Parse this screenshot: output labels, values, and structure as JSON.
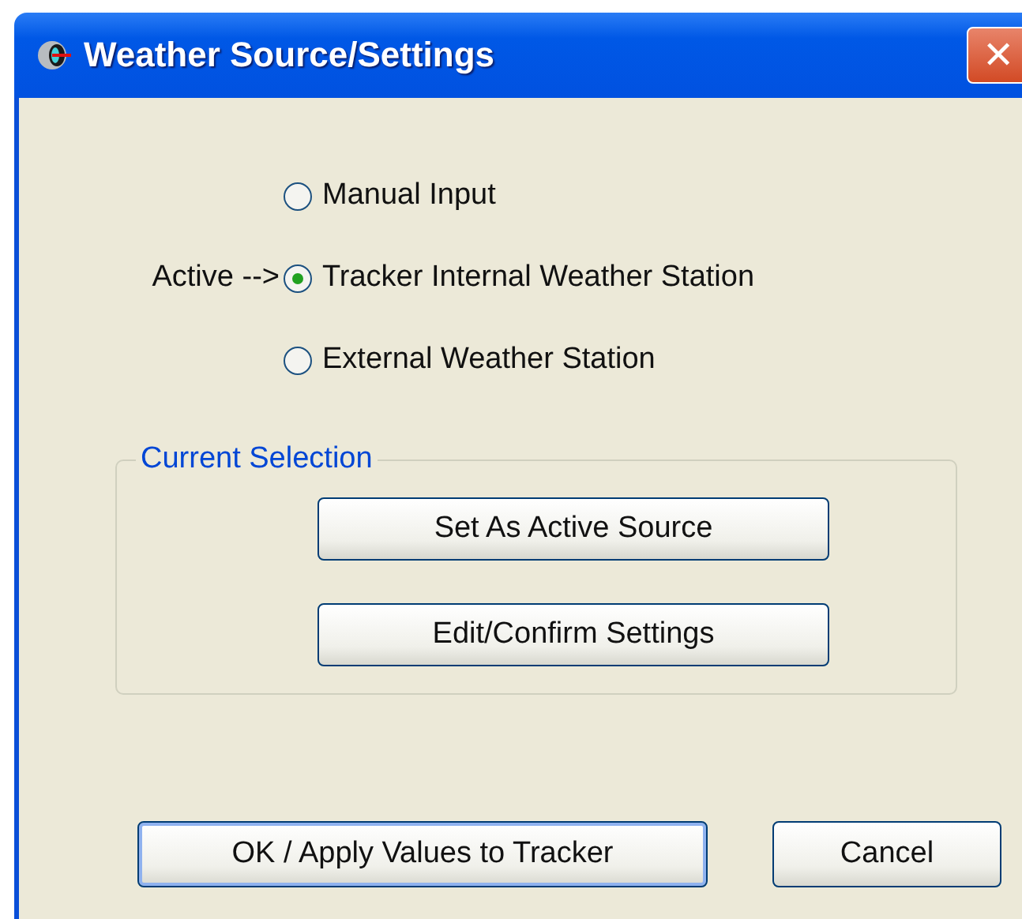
{
  "window": {
    "title": "Weather Source/Settings",
    "close": "✕"
  },
  "sources": [
    {
      "label": "Manual Input",
      "selected": false
    },
    {
      "label": "Tracker Internal Weather Station",
      "selected": true,
      "active_label": "Active -->"
    },
    {
      "label": "External Weather Station",
      "selected": false
    }
  ],
  "current_selection": {
    "legend": "Current Selection",
    "buttons": [
      "Set As Active Source",
      "Edit/Confirm Settings"
    ]
  },
  "buttons": [
    {
      "label": "OK / Apply Values to Tracker",
      "default": true
    },
    {
      "label": "Cancel",
      "default": false
    }
  ]
}
